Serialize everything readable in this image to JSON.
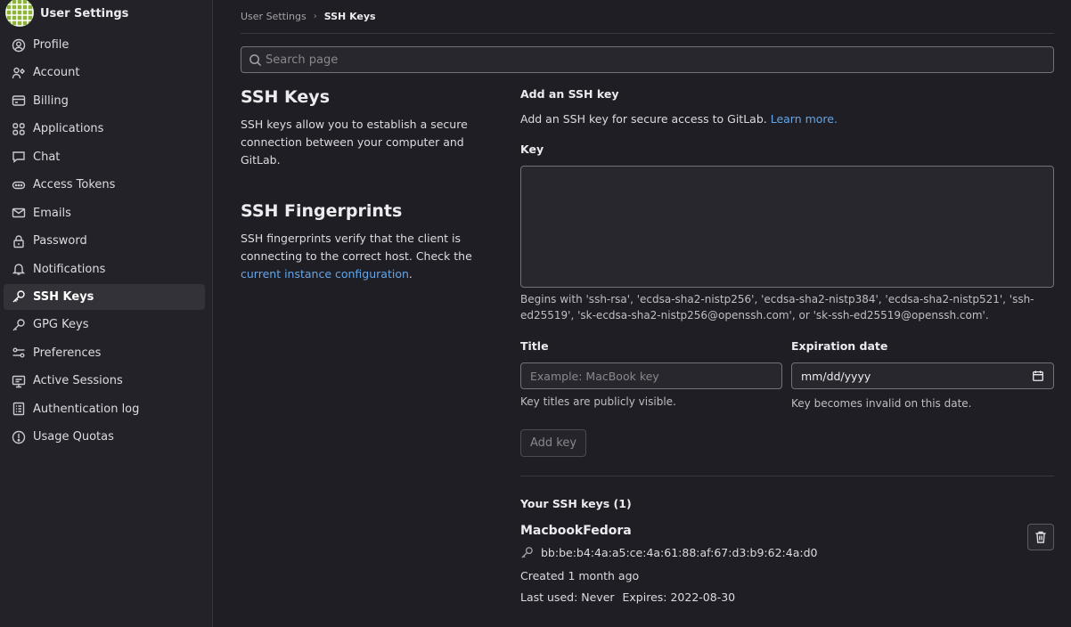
{
  "sidebar": {
    "title": "User Settings",
    "items": [
      {
        "label": "Profile",
        "icon": "profile-icon"
      },
      {
        "label": "Account",
        "icon": "account-icon"
      },
      {
        "label": "Billing",
        "icon": "billing-icon"
      },
      {
        "label": "Applications",
        "icon": "applications-icon"
      },
      {
        "label": "Chat",
        "icon": "chat-icon"
      },
      {
        "label": "Access Tokens",
        "icon": "token-icon"
      },
      {
        "label": "Emails",
        "icon": "mail-icon"
      },
      {
        "label": "Password",
        "icon": "lock-icon"
      },
      {
        "label": "Notifications",
        "icon": "bell-icon"
      },
      {
        "label": "SSH Keys",
        "icon": "key-icon"
      },
      {
        "label": "GPG Keys",
        "icon": "key-icon"
      },
      {
        "label": "Preferences",
        "icon": "preferences-icon"
      },
      {
        "label": "Active Sessions",
        "icon": "monitor-icon"
      },
      {
        "label": "Authentication log",
        "icon": "log-icon"
      },
      {
        "label": "Usage Quotas",
        "icon": "quota-icon"
      }
    ]
  },
  "breadcrumb": {
    "parent": "User Settings",
    "separator": "›",
    "current": "SSH Keys"
  },
  "search": {
    "placeholder": "Search page"
  },
  "intro": {
    "ssh_title": "SSH Keys",
    "ssh_desc": "SSH keys allow you to establish a secure connection between your computer and GitLab.",
    "fp_title": "SSH Fingerprints",
    "fp_desc_before": "SSH fingerprints verify that the client is connecting to the correct host. Check the ",
    "fp_link": "current instance configuration",
    "fp_desc_after": "."
  },
  "form": {
    "heading": "Add an SSH key",
    "desc": "Add an SSH key for secure access to GitLab. ",
    "learn_more": "Learn more.",
    "key_label": "Key",
    "key_help": "Begins with 'ssh-rsa', 'ecdsa-sha2-nistp256', 'ecdsa-sha2-nistp384', 'ecdsa-sha2-nistp521', 'ssh-ed25519', 'sk-ecdsa-sha2-nistp256@openssh.com', or 'sk-ssh-ed25519@openssh.com'.",
    "title_label": "Title",
    "title_placeholder": "Example: MacBook key",
    "title_help": "Key titles are publicly visible.",
    "exp_label": "Expiration date",
    "exp_value": "mm/dd/yyyy",
    "exp_help": "Key becomes invalid on this date.",
    "add_button": "Add key"
  },
  "keys": {
    "heading": "Your SSH keys (1)",
    "items": [
      {
        "name": "MacbookFedora",
        "fingerprint": "bb:be:b4:4a:a5:ce:4a:61:88:af:67:d3:b9:62:4a:d0",
        "created": "Created 1 month ago",
        "last_used": "Last used: Never",
        "expires": "Expires: 2022-08-30"
      }
    ]
  }
}
